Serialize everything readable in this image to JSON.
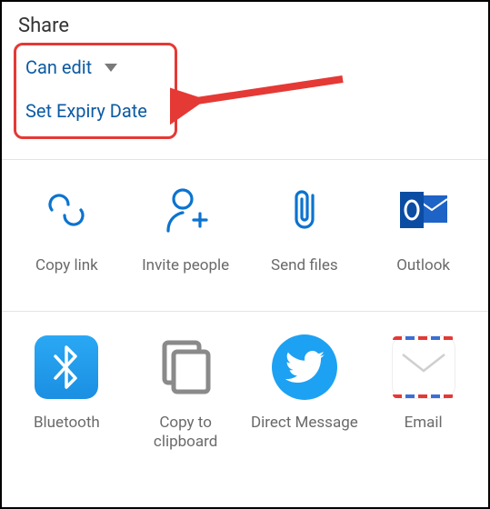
{
  "header": {
    "title": "Share"
  },
  "permission": {
    "label": "Can edit"
  },
  "expiry": {
    "label": "Set Expiry Date"
  },
  "row1": [
    {
      "label": "Copy link",
      "icon": "link-icon"
    },
    {
      "label": "Invite people",
      "icon": "invite-icon"
    },
    {
      "label": "Send files",
      "icon": "attach-icon"
    },
    {
      "label": "Outlook",
      "icon": "outlook-icon"
    }
  ],
  "row2": [
    {
      "label": "Bluetooth",
      "icon": "bluetooth-icon"
    },
    {
      "label": "Copy to clipboard",
      "icon": "clipboard-icon"
    },
    {
      "label": "Direct Message",
      "icon": "twitter-icon"
    },
    {
      "label": "Email",
      "icon": "email-icon"
    }
  ],
  "colors": {
    "accent": "#0b73d0",
    "link": "#0b5aa4",
    "highlight": "#e53935"
  }
}
